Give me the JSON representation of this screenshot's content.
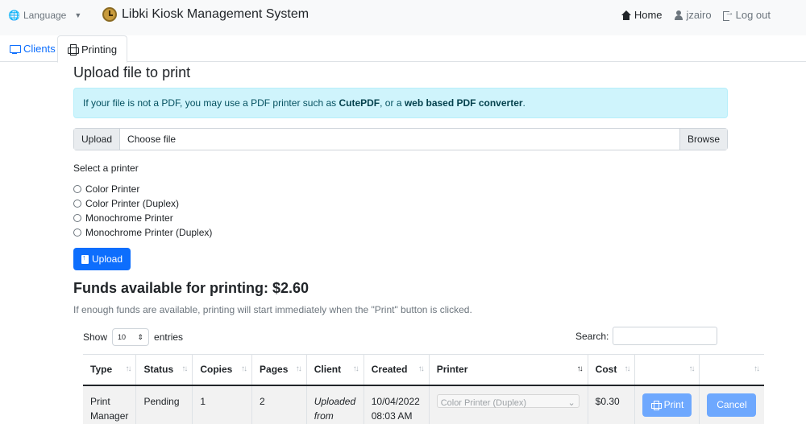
{
  "navbar": {
    "language_label": "Language",
    "brand_title": "Libki Kiosk Management System",
    "home_label": "Home",
    "user_label": "jzairo",
    "logout_label": "Log out"
  },
  "tabs": [
    {
      "label": "Clients",
      "active": false
    },
    {
      "label": "Printing",
      "active": true
    }
  ],
  "upload": {
    "heading": "Upload file to print",
    "alert_prefix": "If your file is not a PDF, you may use a PDF printer such as ",
    "alert_link1": "CutePDF",
    "alert_middle": ", or a ",
    "alert_link2": "web based PDF converter",
    "alert_suffix": ".",
    "file_label": "Upload",
    "file_placeholder": "Choose file",
    "browse_label": "Browse",
    "select_printer_label": "Select a printer",
    "printers": [
      "Color Printer",
      "Color Printer (Duplex)",
      "Monochrome Printer",
      "Monochrome Printer (Duplex)"
    ],
    "upload_button": "Upload"
  },
  "funds": {
    "heading": "Funds available for printing: $2.60",
    "note": "If enough funds are available, printing will start immediately when the \"Print\" button is clicked."
  },
  "table_controls": {
    "show_label": "Show",
    "page_size": "10",
    "entries_label": "entries",
    "search_label": "Search:",
    "search_value": ""
  },
  "table": {
    "columns": [
      "Type",
      "Status",
      "Copies",
      "Pages",
      "Client",
      "Created",
      "Printer",
      "Cost",
      "",
      ""
    ],
    "rows": [
      {
        "type_line1": "Print",
        "type_line2": "Manager",
        "status": "Pending",
        "copies": "1",
        "pages": "2",
        "client_line1": "Uploaded",
        "client_line2": "from",
        "created_line1": "10/04/2022",
        "created_line2": "08:03 AM",
        "printer": "Color Printer (Duplex)",
        "cost": "$0.30",
        "print_button": "Print",
        "cancel_button": "Cancel"
      }
    ]
  }
}
